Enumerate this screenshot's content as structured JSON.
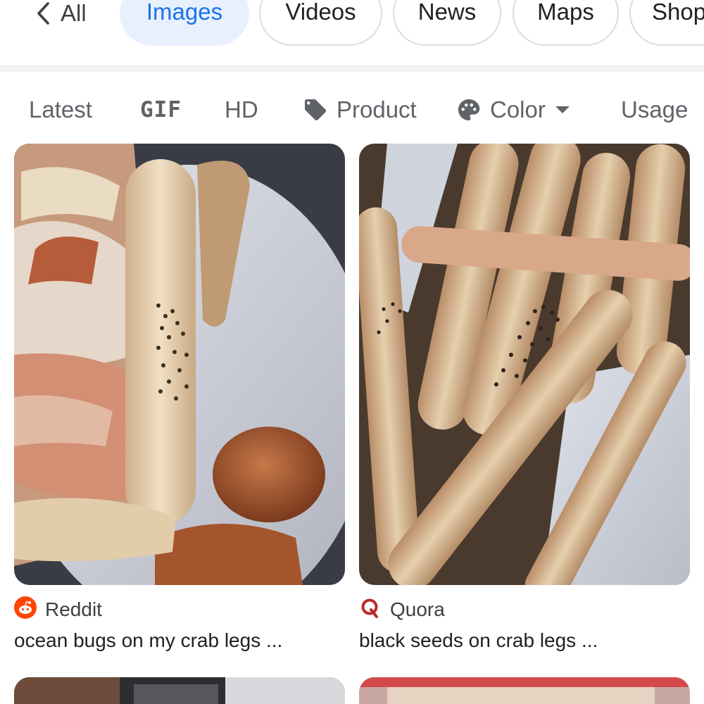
{
  "tabs": {
    "back_label": "All",
    "items": [
      {
        "label": "Images",
        "active": true
      },
      {
        "label": "Videos",
        "active": false
      },
      {
        "label": "News",
        "active": false
      },
      {
        "label": "Maps",
        "active": false
      },
      {
        "label": "Shop",
        "active": false
      }
    ]
  },
  "filters": {
    "latest": "Latest",
    "gif": "GIF",
    "hd": "HD",
    "product": "Product",
    "color": "Color",
    "usage": "Usage"
  },
  "results": [
    {
      "source_name": "Reddit",
      "source_icon": "reddit-icon",
      "source_color": "#ff4500",
      "title": "ocean bugs on my crab legs ..."
    },
    {
      "source_name": "Quora",
      "source_icon": "quora-icon",
      "source_color": "#b92b27",
      "title": "black seeds on crab legs ..."
    }
  ],
  "colors": {
    "accent": "#1a73e8",
    "active_tab_bg": "#e8f0fe",
    "chip_text": "#5f6368"
  }
}
